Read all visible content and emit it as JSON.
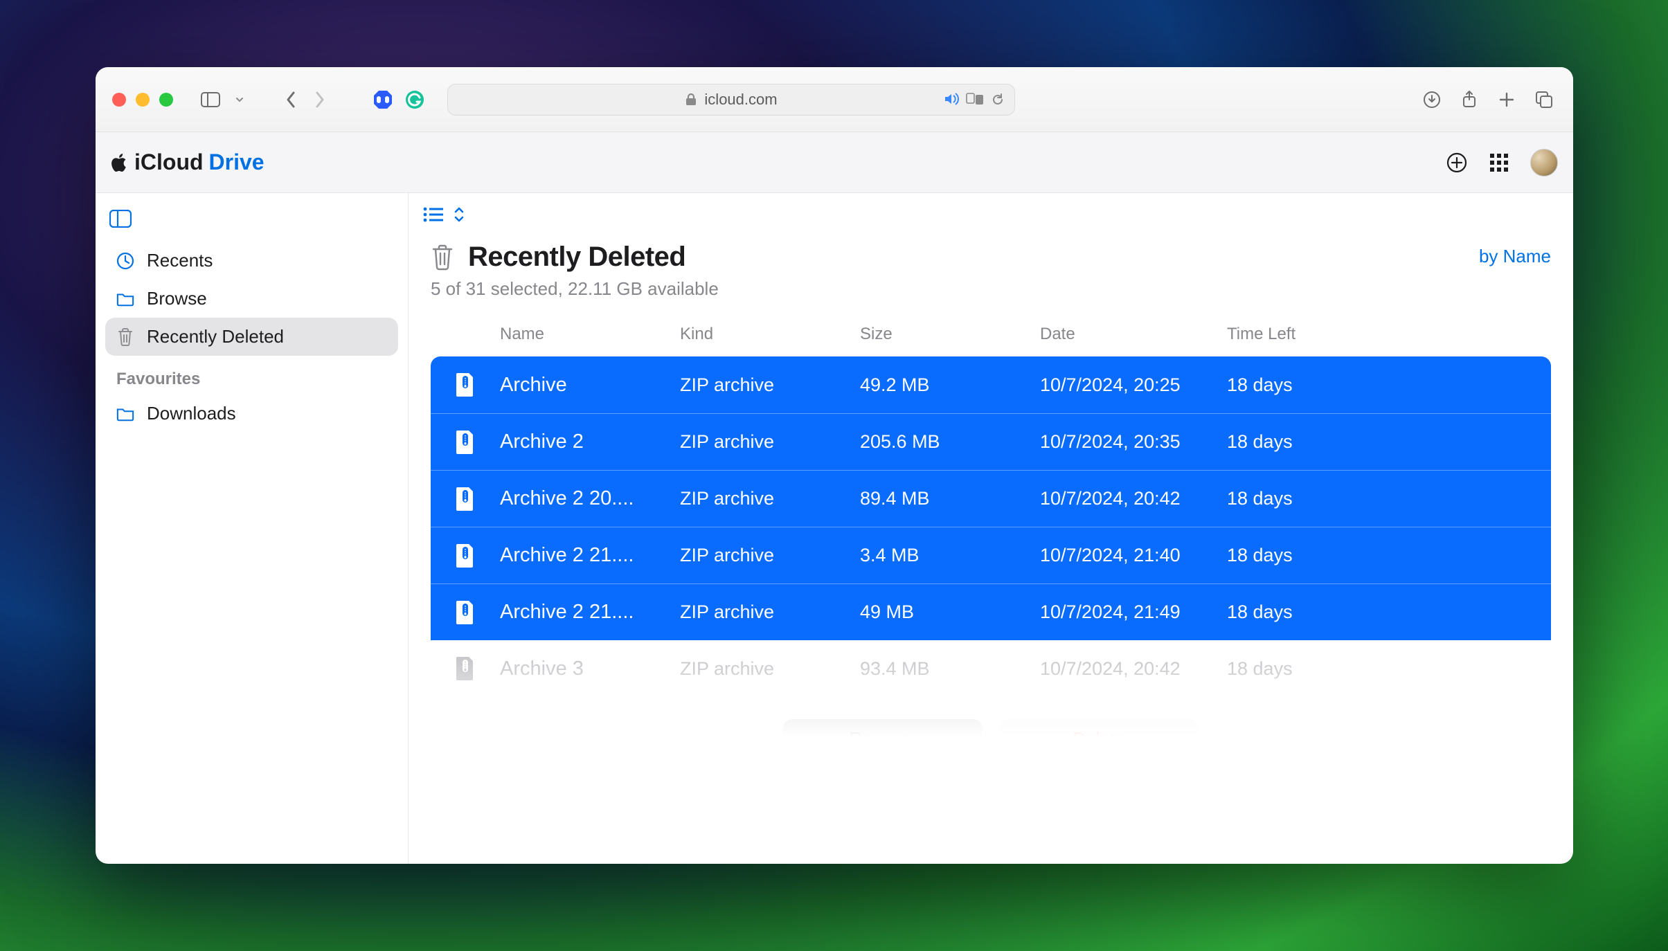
{
  "browser": {
    "url_display": "icloud.com"
  },
  "brand": {
    "prefix": "iCloud",
    "suffix": "Drive"
  },
  "sidebar": {
    "items": [
      {
        "label": "Recents"
      },
      {
        "label": "Browse"
      },
      {
        "label": "Recently Deleted"
      }
    ],
    "fav_section": "Favourites",
    "fav_items": [
      {
        "label": "Downloads"
      }
    ]
  },
  "page": {
    "title": "Recently Deleted",
    "subtitle": "5 of 31 selected, 22.11 GB available",
    "sort_label": "by Name"
  },
  "columns": {
    "name": "Name",
    "kind": "Kind",
    "size": "Size",
    "date": "Date",
    "time_left": "Time Left"
  },
  "rows": [
    {
      "name": "Archive",
      "kind": "ZIP archive",
      "size": "49.2 MB",
      "date": "10/7/2024, 20:25",
      "time_left": "18 days",
      "selected": true
    },
    {
      "name": "Archive 2",
      "kind": "ZIP archive",
      "size": "205.6 MB",
      "date": "10/7/2024, 20:35",
      "time_left": "18 days",
      "selected": true
    },
    {
      "name": "Archive 2 20....",
      "kind": "ZIP archive",
      "size": "89.4 MB",
      "date": "10/7/2024, 20:42",
      "time_left": "18 days",
      "selected": true
    },
    {
      "name": "Archive 2 21....",
      "kind": "ZIP archive",
      "size": "3.4 MB",
      "date": "10/7/2024, 21:40",
      "time_left": "18 days",
      "selected": true
    },
    {
      "name": "Archive 2 21....",
      "kind": "ZIP archive",
      "size": "49 MB",
      "date": "10/7/2024, 21:49",
      "time_left": "18 days",
      "selected": true
    },
    {
      "name": "Archive 3",
      "kind": "ZIP archive",
      "size": "93.4 MB",
      "date": "10/7/2024, 20:42",
      "time_left": "18 days",
      "selected": false
    }
  ],
  "footer": {
    "recover": "Recover",
    "delete": "Delete"
  }
}
